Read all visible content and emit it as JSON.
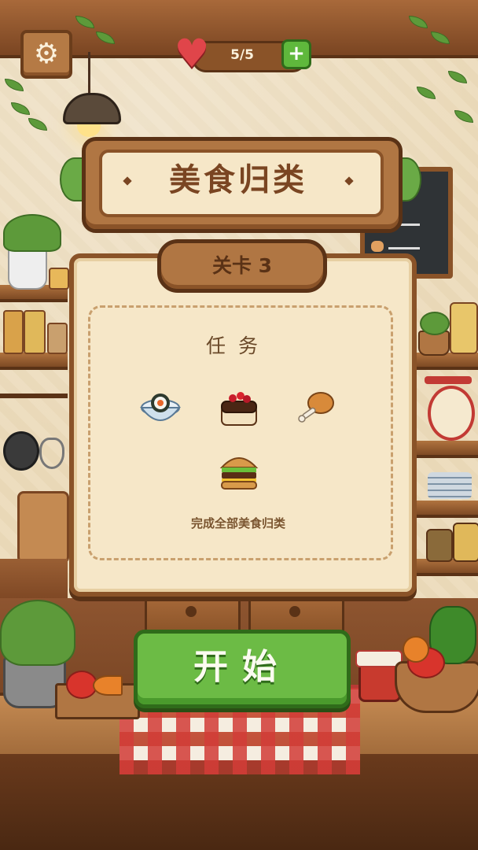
{
  "game": {
    "title": "美食归类",
    "level_label": "关卡 3",
    "lives_text": "5/5",
    "task_title": "任务",
    "task_description": "完成全部美食归类",
    "start_label": "开始"
  },
  "task_items": [
    {
      "name": "sushi-bowl"
    },
    {
      "name": "berry-cake"
    },
    {
      "name": "chicken-leg"
    },
    {
      "name": "burger"
    }
  ],
  "icons": {
    "settings": "gear-icon",
    "lives": "heart-icon",
    "add_life": "plus-icon"
  },
  "colors": {
    "accent_green": "#6cbb45",
    "wood": "#8a5328",
    "panel": "#f6e7c8",
    "heart": "#e0454a"
  }
}
